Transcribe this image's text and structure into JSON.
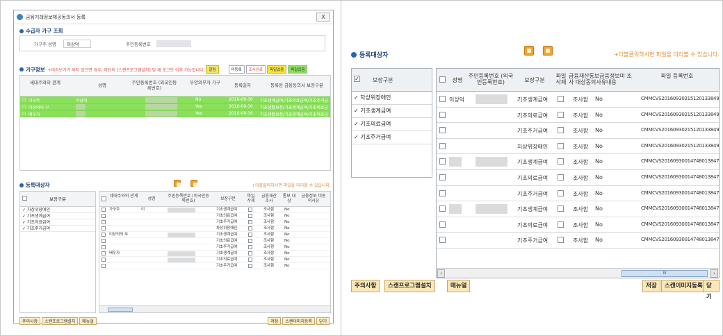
{
  "left_window": {
    "title": "금융거래정보제공동의서 등록",
    "close_label": "X",
    "household_section": {
      "title": "수급자 가구 조회",
      "head_name_label": "가구주 성명",
      "head_name_value": "이상덕",
      "rrn_label": "주민등록번호"
    },
    "household_info": {
      "title": "가구정보",
      "note": "+미리보기가 되지 않으면 경우, 하단의 [스캔프로그램설치] 및 재 로그인 이후 가능합니다.",
      "pill_alert": "알림",
      "pill_unregistered": "미등록",
      "pill_survey": "조사완료",
      "pill_file_missing": "파일없음",
      "pill_file_exists": "파일있음",
      "columns": [
        "세대주와의 관계",
        "성명",
        "주민등록번호 (외국인등록번호)",
        "부양의무자 가구",
        "등록일자",
        "등록된 금융동의서 보장구분"
      ],
      "rows": [
        {
          "relation": "가구주",
          "name": "이상덕",
          "obligor": "No",
          "date": "2016-09-30",
          "types": "기초생계급여/기초의료급여/기초주거급"
        },
        {
          "relation": "이상덕의 부",
          "name": "",
          "obligor": "Yes",
          "date": "2016-09-30",
          "types": "기초생활보장/기초생계급여/기초의료급"
        },
        {
          "relation": "배우자",
          "name": "",
          "obligor": "Yes",
          "date": "2016-09-30",
          "types": "기초생활보장/기초생계급여/기초의료급"
        }
      ]
    },
    "registration": {
      "title": "등록대상자",
      "note": "+더블클릭하시면 파일을 미리볼 수 있습니다.",
      "left_header": "보장구분",
      "left_items": [
        "차상위장애인",
        "기초생계급여",
        "기초의료급여",
        "기초주거급여"
      ],
      "columns": [
        "세대주와의 관계",
        "성명",
        "주민등록번호 (외국인등록번호)",
        "보장구분",
        "파일 삭제",
        "금융재산 조사",
        "통보 대상",
        "금융정보 미동의사유"
      ],
      "rows": [
        {
          "relation": "가구주",
          "name": "이",
          "type": "기초생계급여",
          "survey": "조사함",
          "notice": "No"
        },
        {
          "relation": "",
          "name": "",
          "type": "기초의료급여",
          "survey": "조사함",
          "notice": "No"
        },
        {
          "relation": "",
          "name": "",
          "type": "기초주거급여",
          "survey": "조사함",
          "notice": "No"
        },
        {
          "relation": "",
          "name": "",
          "type": "차상위장애인",
          "survey": "조사함",
          "notice": "No"
        },
        {
          "relation": "이상덕의 부",
          "name": "",
          "type": "기초생계급여",
          "survey": "조사함",
          "notice": "No"
        },
        {
          "relation": "",
          "name": "",
          "type": "기초의료급여",
          "survey": "조사함",
          "notice": "No"
        },
        {
          "relation": "",
          "name": "",
          "type": "기초주거급여",
          "survey": "조사함",
          "notice": "No"
        },
        {
          "relation": "배우자",
          "name": "",
          "type": "기초생계급여",
          "survey": "조사함",
          "notice": "No"
        },
        {
          "relation": "",
          "name": "",
          "type": "기초의료급여",
          "survey": "조사함",
          "notice": "No"
        },
        {
          "relation": "",
          "name": "",
          "type": "기초주거급여",
          "survey": "조사함",
          "notice": "No"
        }
      ]
    },
    "buttons": {
      "notice": "주의사항",
      "install": "스캔프로그램설치",
      "manual": "매뉴얼",
      "save": "저장",
      "scan": "스캔이미지등록",
      "close": "닫기"
    }
  },
  "right_panel": {
    "title": "등록대상자",
    "note": "+더블클릭하시면 파일을 미리볼 수 있습니다.",
    "left_header": "보장구분",
    "left_items": [
      "차상위장애인",
      "기초생계급여",
      "기초의료급여",
      "기초주거급여"
    ],
    "columns": [
      "성명",
      "주민등록번호 (외국인등록번호)",
      "보장구분",
      "파일 삭제",
      "금융재산 조사",
      "통보 대상",
      "금융정보 미동의사유",
      "파일 등록번호"
    ],
    "column_overlap_text": "금융재산통보금융정보미 조사 대상동의사유내용",
    "rows": [
      {
        "name": "이상덕",
        "type": "기초생계급여",
        "survey": "조사함",
        "notice": "No",
        "file": "CMMCVS20160930215120133849466"
      },
      {
        "name": "",
        "type": "기초의료급여",
        "survey": "조사함",
        "notice": "No",
        "file": "CMMCVS20160930215120133849466"
      },
      {
        "name": "",
        "type": "기초주거급여",
        "survey": "조사함",
        "notice": "No",
        "file": "CMMCVS20160930215120133849466"
      },
      {
        "name": "",
        "type": "차상위장애인",
        "survey": "조사함",
        "notice": "No",
        "file": "CMMCVS20160930215120133849466"
      },
      {
        "name": "",
        "type": "기초생계급여",
        "survey": "조사함",
        "notice": "No",
        "file": "CMMCVS20160930014748013847131"
      },
      {
        "name": "",
        "type": "기초의료급여",
        "survey": "조사함",
        "notice": "No",
        "file": "CMMCVS20160930014748013847131"
      },
      {
        "name": "",
        "type": "기초주거급여",
        "survey": "조사함",
        "notice": "No",
        "file": "CMMCVS20160930014748013847131"
      },
      {
        "name": "",
        "type": "기초생계급여",
        "survey": "조사함",
        "notice": "No",
        "file": "CMMCVS20160930014748013847131"
      },
      {
        "name": "",
        "type": "기초의료급여",
        "survey": "조사함",
        "notice": "No",
        "file": "CMMCVS20160930014748013847131"
      },
      {
        "name": "",
        "type": "기초주거급여",
        "survey": "조사함",
        "notice": "No",
        "file": "CMMCVS20160930014748013847131"
      }
    ],
    "scroll_thumb_label": "III",
    "buttons": {
      "notice": "주의사항",
      "install": "스캔프로그램설치",
      "manual": "매뉴얼",
      "save": "저장",
      "scan": "스캔이미지등록",
      "close": "닫기"
    }
  },
  "colors": {
    "accent": "#1d3f7a",
    "highlight_row": "#8ae05a",
    "note_orange": "#e48a2b",
    "button_bg": "#fbe8b8"
  }
}
